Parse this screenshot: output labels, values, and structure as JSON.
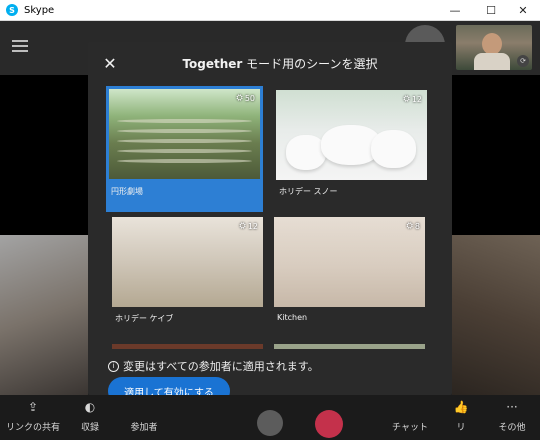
{
  "window": {
    "title": "Skype",
    "minimize": "—",
    "maximize": "☐",
    "close": "✕"
  },
  "modal": {
    "title_bold": "Together",
    "title_rest": " モード用のシーンを選択",
    "close_icon": "close-icon",
    "scenes": [
      {
        "name": "円形劇場",
        "count": "50",
        "selected": true
      },
      {
        "name": "ホリデー スノー",
        "count": "12",
        "selected": false
      },
      {
        "name": "ホリデー ケイブ",
        "count": "12",
        "selected": false
      },
      {
        "name": "Kitchen",
        "count": "8",
        "selected": false
      }
    ],
    "info_text": "変更はすべての参加者に適用されます。",
    "apply_label": "適用して有効にする"
  },
  "callbar": {
    "items": [
      {
        "label": "リンクの共有",
        "icon": "share-icon"
      },
      {
        "label": "収録",
        "icon": "record-icon"
      },
      {
        "label": "参加者",
        "icon": "participants-icon"
      },
      {
        "label": "チャット",
        "icon": "chat-icon"
      },
      {
        "label": "リ",
        "icon": "reaction-icon"
      },
      {
        "label": "その他",
        "icon": "more-icon"
      }
    ]
  },
  "colors": {
    "accent": "#1a73d3",
    "selected": "#2d7fd4",
    "end_call": "#c4314b",
    "modal_bg": "#2a2a2a"
  }
}
